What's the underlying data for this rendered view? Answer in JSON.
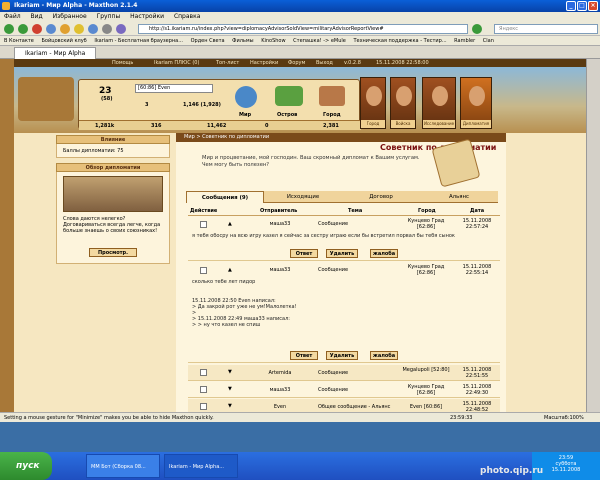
{
  "window": {
    "title": "Ikariam - Мир Alpha - Maxthon 2.1.4"
  },
  "menu": [
    "Файл",
    "Вид",
    "Избранное",
    "Группы",
    "Настройки",
    "Справка"
  ],
  "address": {
    "url": "http://s1.ikariam.ru/index.php?view=diplomacyAdvisorSoldView=militaryAdvisorReportView#"
  },
  "search": {
    "placeholder": "Яндекс"
  },
  "favorites": [
    "В Контакте",
    "Бойцовский клуб",
    "Ikariam - Бесплатная браузерна...",
    "Орден Света",
    "Фильмы",
    "KinoShow",
    "Степашка! -> eMule",
    "Техническая поддержка - Тестир...",
    "Rambler",
    "Clan"
  ],
  "tab": {
    "label": "Ikariam - Мир Alpha"
  },
  "ik_nav": [
    "Помощь",
    "Ikariam ПЛЮС (0)",
    "Топ-лист",
    "Настройки",
    "Форум",
    "Выход",
    "v.0.2.8",
    "15.11.2008 22:58:00"
  ],
  "city": {
    "name": "[60:86] Even",
    "pop": "23",
    "pop_sub": "(58)",
    "wood_rate": "3",
    "citizens": "1,146 (1,928)",
    "wood": "1,281k",
    "wine": "316",
    "marble": "11,462",
    "crystal": "0",
    "sulfur": "2,381"
  },
  "views": {
    "world": "Мир",
    "island": "Остров",
    "town": "Город"
  },
  "advisors": [
    "Город",
    "Войска",
    "Исследование",
    "Дипломатия"
  ],
  "left": {
    "influence_header": "Влияние",
    "influence_text": "Баллы дипломатии: 75",
    "overview_header": "Обзор дипломатии",
    "overview_text": "Слова даются нелегко? Договариваться всегда легче, когда больше знаешь о своих союзниках!",
    "view_button": "Просмотр."
  },
  "right": {
    "breadcrumb": "Мир > Советник по дипломатии",
    "title": "Советник по дипломатии",
    "intro": "Мир и процветание, мой господин. Ваш скромный дипломат к Вашим услугам. Чем могу быть полезен?",
    "tabs": [
      "Сообщения (9)",
      "Исходящие",
      "Договор",
      "Альянс"
    ],
    "columns": [
      "Действие",
      "Отправитель",
      "Тема",
      "Город",
      "Дата"
    ],
    "buttons": {
      "reply": "Ответ",
      "delete": "Удалить",
      "report": "жалоба"
    },
    "open_rows": [
      {
        "arrow": "▲",
        "sender": "маша33",
        "subject": "Сообщение",
        "city": "Кунцево Град [62:86]",
        "date": "15.11.2008 22:57:24",
        "body": "я тебя обосру на всю игру казел я сейчас за сестру играю если бы встретил порвал бы тебя сынок"
      },
      {
        "arrow": "▲",
        "sender": "маша33",
        "subject": "Сообщение",
        "city": "Кунцево Град [62:86]",
        "date": "15.11.2008 22:55:14",
        "body": "сколько тебе лет пидор\n\n\n15.11.2008 22:50 Even написал:\n> Да закрой рот уже не ум!Малолетка!\n>\n> 15.11.2008 22:49 маша33 написал:\n> > ну что казел не спиш"
      }
    ],
    "rows": [
      {
        "arrow": "▼",
        "sender": "Artemida",
        "subject": "Сообщение",
        "city": "Megalupoli [52:80]",
        "date": "15.11.2008 22:51:55"
      },
      {
        "arrow": "▼",
        "sender": "маша33",
        "subject": "Сообщение",
        "city": "Кунцево Град [62:86]",
        "date": "15.11.2008 22:49:30"
      },
      {
        "arrow": "▼",
        "sender": "Even",
        "subject": "Общее сообщение - Альянс",
        "city": "Even [60:86]",
        "date": "15.11.2008 22:48:52"
      },
      {
        "arrow": "▼",
        "sender": "Artemida",
        "subject": "Сообщение",
        "city": "Megalupoli [52:80]",
        "date": "15.11.2008 22:47:11"
      },
      {
        "arrow": "▼",
        "sender": "Even",
        "subject": "Общее сообщение - Альянс",
        "city": "Even [60:86]",
        "date": "15.11.2008 22:30:30"
      }
    ]
  },
  "status": {
    "text": "Setting a mouse gesture for \"Minimize\" makes you be able to hide Maxthon quickly.",
    "time": "23:59:33",
    "zoom": "Масштаб:100%"
  },
  "taskbar": {
    "start": "пуск",
    "tasks": [
      "ММ Бот (Сборка 08...",
      "Ikariam - Мир Alpha..."
    ],
    "clock": "23:59",
    "day": "суббота",
    "date": "15.11.2008"
  },
  "watermark": "photo.qip.ru"
}
